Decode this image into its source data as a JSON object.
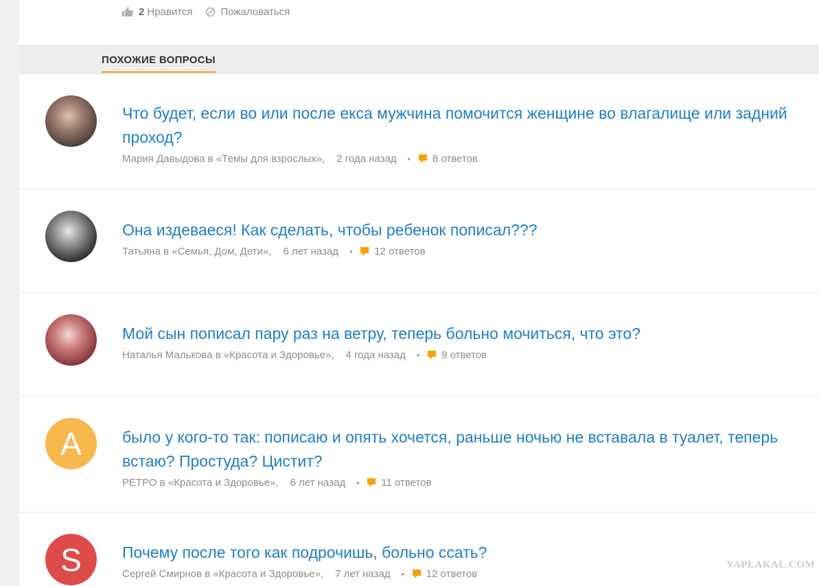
{
  "actions": {
    "like_count": "2",
    "like_label": "Нравится",
    "report_label": "Пожаловаться"
  },
  "section": {
    "tab_label": "ПОХОЖИЕ ВОПРОСЫ"
  },
  "questions": [
    {
      "title": "Что будет, если во или после екса мужчина помочится женщине во влагалище или задний проход?",
      "author": "Мария Давыдова в «Темы для взрослых»,",
      "ago": "2 года назад",
      "dot": "•",
      "answers": "8 ответов",
      "avatar": {
        "type": "photo",
        "colors": [
          "#3b3533",
          "#9c7a6c",
          "#d8c0b4"
        ]
      }
    },
    {
      "title": "Она издеваеся! Как сделать, чтобы ребенок пописал???",
      "author": "Татьяна в «Семья, Дом, Дети»,",
      "ago": "6 лет назад",
      "dot": "•",
      "answers": "12 ответов",
      "avatar": {
        "type": "photo",
        "colors": [
          "#1e1e1e",
          "#8c8c8c",
          "#e6e6e6"
        ]
      }
    },
    {
      "title": "Мой сын пописал пару раз на ветру, теперь больно мочиться, что это?",
      "author": "Наталья Малькова в «Красота и Здоровье»,",
      "ago": "4 года назад",
      "dot": "•",
      "answers": "9 ответов",
      "avatar": {
        "type": "photo",
        "colors": [
          "#7a2a30",
          "#c87878",
          "#f0d8d4"
        ]
      }
    },
    {
      "title": "было у кого-то так: пописаю и опять хочется, раньше ночью не вставала в туалет, теперь встаю? Простуда? Цистит?",
      "author": "РЕТРО в «Красота и Здоровье»,",
      "ago": "6 лет назад",
      "dot": "•",
      "answers": "11 ответов",
      "avatar": {
        "type": "letter",
        "letter": "A",
        "color": "#f8b84e"
      }
    },
    {
      "title": "Почему после того как подрочишь, больно ссать?",
      "author": "Сергей Смирнов в «Красота и Здоровье»,",
      "ago": "7 лет назад",
      "dot": "•",
      "answers": "12 ответов",
      "avatar": {
        "type": "letter",
        "letter": "S",
        "color": "#dd4b4b"
      }
    }
  ],
  "colors": {
    "link": "#1f7ec7",
    "meta": "#8c8c8c",
    "accent": "#f0a020",
    "answer_icon": "#f5a20a"
  },
  "watermark": "YAPLAKAL.COM"
}
